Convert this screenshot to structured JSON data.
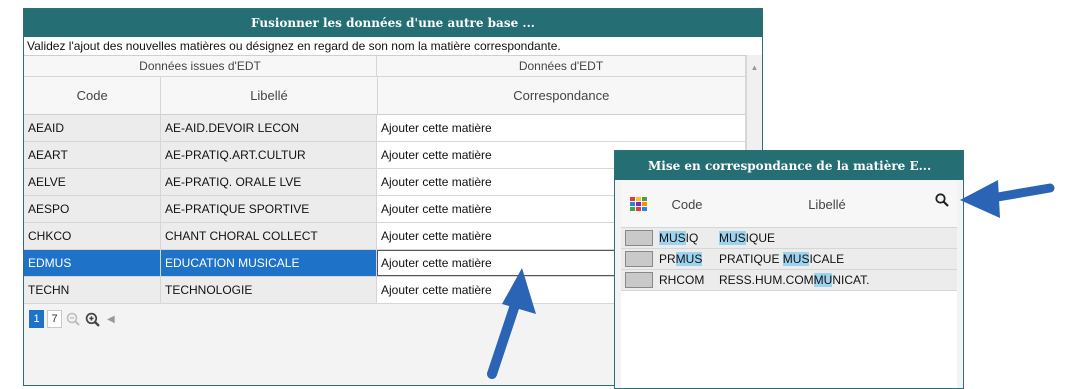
{
  "main_dialog": {
    "title": "Fusionner les données d'une autre base ...",
    "instructions": "Validez l'ajout des nouvelles matières ou désignez en regard de son nom la matière correspondante.",
    "group_headers": {
      "source": "Données issues d'EDT",
      "target": "Données d'EDT"
    },
    "columns": {
      "code": "Code",
      "libelle": "Libellé",
      "correspondance": "Correspondance"
    },
    "rows": [
      {
        "code": "AEAID",
        "libelle": "AE-AID.DEVOIR LECON",
        "correspondance": "Ajouter cette matière"
      },
      {
        "code": "AEART",
        "libelle": "AE-PRATIQ.ART.CULTUR",
        "correspondance": "Ajouter cette matière"
      },
      {
        "code": "AELVE",
        "libelle": "AE-PRATIQ. ORALE LVE",
        "correspondance": "Ajouter cette matière"
      },
      {
        "code": "AESPO",
        "libelle": "AE-PRATIQUE SPORTIVE",
        "correspondance": "Ajouter cette matière"
      },
      {
        "code": "CHKCO",
        "libelle": "CHANT CHORAL COLLECT",
        "correspondance": "Ajouter cette matière"
      },
      {
        "code": "EDMUS",
        "libelle": "EDUCATION MUSICALE",
        "correspondance": "Ajouter cette matière"
      },
      {
        "code": "TECHN",
        "libelle": "TECHNOLOGIE",
        "correspondance": "Ajouter cette matière"
      }
    ],
    "selected_row_code": "EDMUS",
    "pager": {
      "current_page": "1",
      "other_page": "7"
    }
  },
  "sub_dialog": {
    "title": "Mise en correspondance de la matière E...",
    "columns": {
      "code": "Code",
      "libelle": "Libellé"
    },
    "rows": [
      {
        "code_pre": "",
        "code_hl": "MUS",
        "code_post": "IQ",
        "lib_pre": "",
        "lib_hl": "MUS",
        "lib_post": "IQUE"
      },
      {
        "code_pre": "PR",
        "code_hl": "MUS",
        "code_post": "",
        "lib_pre": "PRATIQUE ",
        "lib_hl": "MUS",
        "lib_post": "ICALE"
      },
      {
        "code_pre": "RHCOM",
        "code_hl": "",
        "code_post": "",
        "lib_pre": "RESS.HUM.COM",
        "lib_hl": "MU",
        "lib_post": "NICAT."
      }
    ]
  },
  "icons": {
    "sort": "sort-arrow-icon",
    "zoom_out": "zoom-out-icon",
    "zoom_in": "zoom-in-icon",
    "prev": "previous-page-icon",
    "column_selector": "column-selector-icon",
    "search": "search-icon"
  },
  "colors": {
    "title_bar": "#256e74",
    "selection": "#1e73c8",
    "highlight": "#9ed3f0",
    "arrow": "#2b63b5"
  }
}
